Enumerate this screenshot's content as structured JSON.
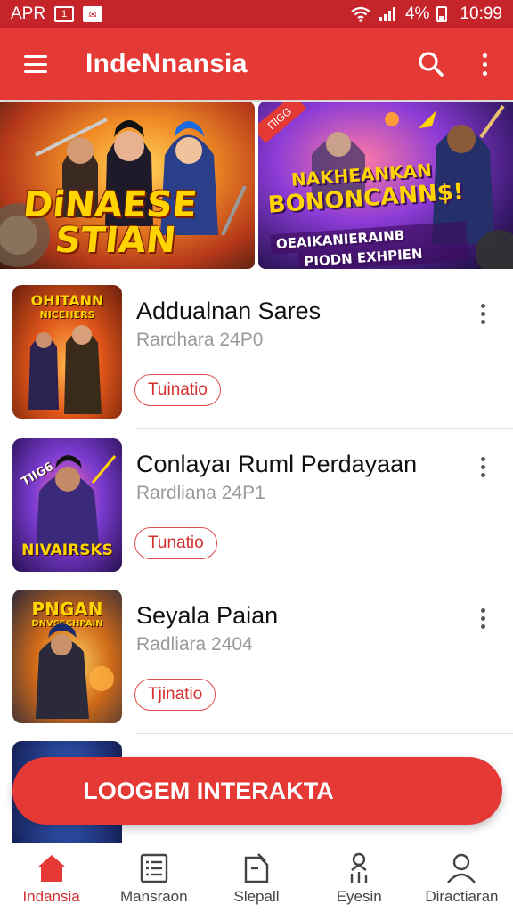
{
  "status_bar": {
    "carrier": "APR",
    "battery": "4%",
    "time": "10:99"
  },
  "app_bar": {
    "title": "IndeNnansia"
  },
  "banners": [
    {
      "line1": "DiNAESE",
      "line2": "STIAN"
    },
    {
      "ribbon": "ПIGG",
      "line1": "NAKHEANKAN",
      "line2": "BONONCANN$!",
      "line3": "OEAIKANIERAINB",
      "line4": "PIODN EXHPIEN"
    }
  ],
  "items": [
    {
      "title": "Addualnan Sares",
      "subtitle": "Rardhara 24P0",
      "tag": "Tuinatio",
      "thumb_text_top": "OHITANN",
      "thumb_text_top2": "NICEHERS",
      "thumb_text_bottom": ""
    },
    {
      "title": "Conlayaı Ruml Perdayaan",
      "subtitle": "Rardliana 24P1",
      "tag": "Tunatio",
      "thumb_text_top": "TIIG6",
      "thumb_text_top2": "",
      "thumb_text_bottom": "NIVAIRSKS"
    },
    {
      "title": "Seyala Paian",
      "subtitle": "Radliara 2404",
      "tag": "Tjinatio",
      "thumb_text_top": "PNGAN",
      "thumb_text_top2": "DNVSSCHPAIN",
      "thumb_text_bottom": ""
    },
    {
      "title": "",
      "subtitle": "",
      "tag": "",
      "thumb_text_top": "",
      "thumb_text_top2": "",
      "thumb_text_bottom": ""
    }
  ],
  "cta": {
    "label": "LOOGEM INTERAKTA"
  },
  "bottom_nav": [
    {
      "label": "Indansia",
      "icon": "home-icon",
      "active": true
    },
    {
      "label": "Mansraon",
      "icon": "list-icon",
      "active": false
    },
    {
      "label": "Slepall",
      "icon": "document-icon",
      "active": false
    },
    {
      "label": "Eyesin",
      "icon": "person-stats-icon",
      "active": false
    },
    {
      "label": "Diractiaran",
      "icon": "profile-icon",
      "active": false
    }
  ],
  "colors": {
    "primary": "#e53935",
    "status_bar": "#c6242b",
    "accent_text": "#d32f2f"
  }
}
